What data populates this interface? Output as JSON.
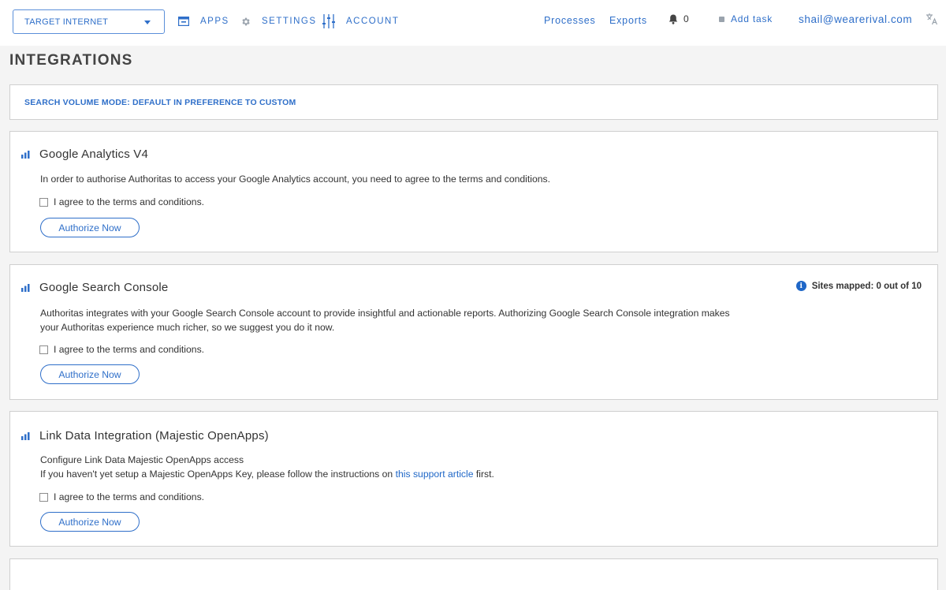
{
  "nav": {
    "account_selector": "TARGET INTERNET",
    "apps": "APPS",
    "settings": "SETTINGS",
    "account": "ACCOUNT",
    "processes": "Processes",
    "exports": "Exports",
    "notification_count": "0",
    "add_task": "Add task",
    "user_email": "shail@wearerival.com"
  },
  "page": {
    "title": "INTEGRATIONS",
    "search_volume_mode": "SEARCH VOLUME MODE: DEFAULT IN PREFERENCE TO CUSTOM"
  },
  "integrations": [
    {
      "title": "Google Analytics V4",
      "description": "In order to authorise Authoritas to access your Google Analytics account, you need to agree to the terms and conditions.",
      "agree_label": "I agree to the terms and conditions.",
      "agreed": false,
      "button": "Authorize Now"
    },
    {
      "title": "Google Search Console",
      "description_line1": "Authoritas integrates with your Google Search Console account to provide insightful and actionable reports. Authorizing Google Search Console integration makes",
      "description_line2": "your Authoritas experience much richer, so we suggest you do it now.",
      "sites_mapped": "Sites mapped: 0 out of 10",
      "agree_label": "I agree to the terms and conditions.",
      "agreed": false,
      "button": "Authorize Now"
    },
    {
      "title": "Link Data Integration (Majestic OpenApps)",
      "description_line1": "Configure Link Data Majestic OpenApps access",
      "description_line2_prefix": "If you haven't yet setup a Majestic OpenApps Key, please follow the instructions on ",
      "link_text": "this support article",
      "description_line2_suffix": " first.",
      "agree_label": "I agree to the terms and conditions.",
      "agreed": false,
      "button": "Authorize Now"
    }
  ],
  "colors": {
    "accent": "#2f6fc9",
    "link": "#1f67c7",
    "background": "#f4f4f4",
    "panel_border": "#cfcfcf"
  }
}
